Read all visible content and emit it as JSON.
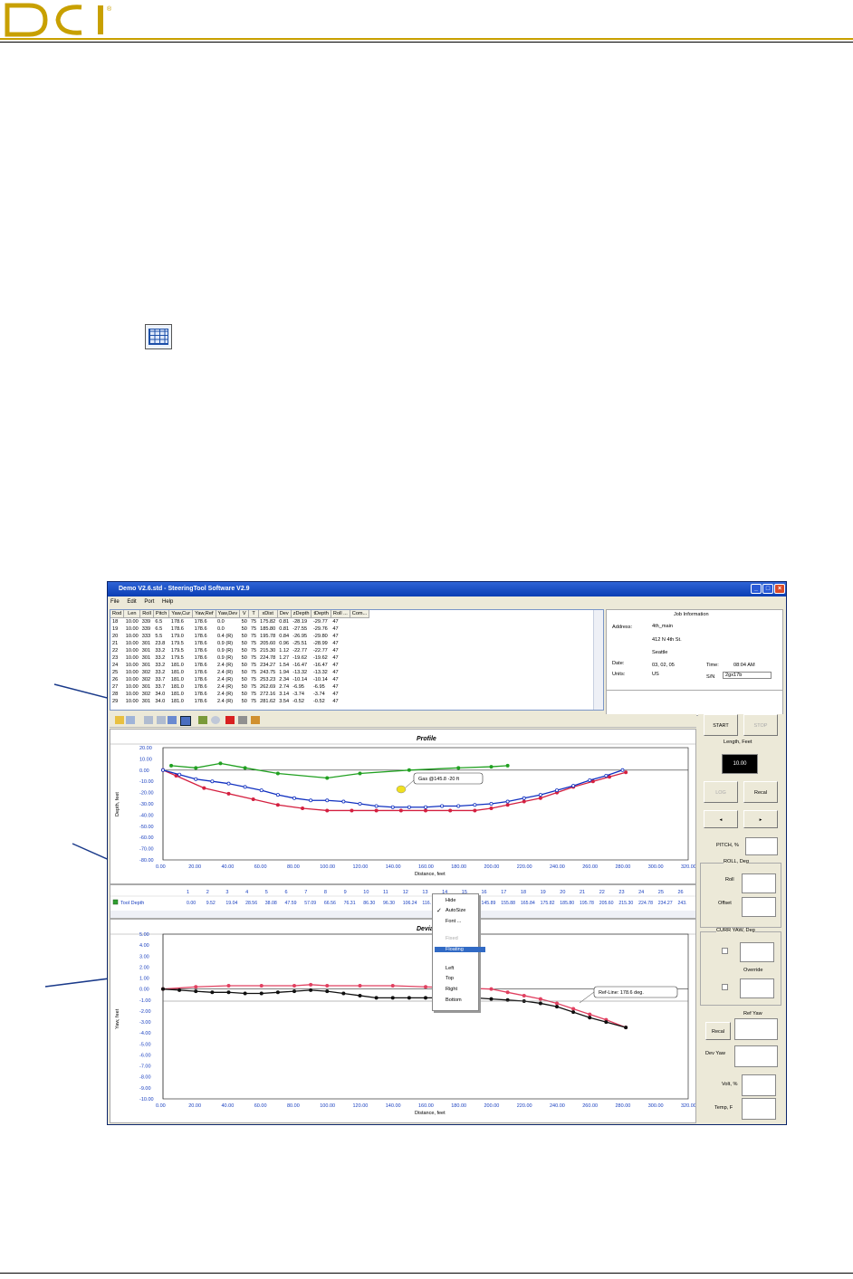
{
  "doc": {
    "logo_text": "DCI"
  },
  "window": {
    "title": "Demo V2.6.std - SteeringTool Software V2.9",
    "menu": [
      "File",
      "Edit",
      "Port",
      "Help"
    ]
  },
  "grid": {
    "headers": [
      "Rod",
      "Len",
      "Roll",
      "Pitch",
      "Yaw,Cur",
      "Yaw,Ref",
      "Yaw,Dev",
      "V",
      "T",
      "xDist",
      "Dev",
      "zDepth",
      "tDepth",
      "Roll ...",
      "Com..."
    ],
    "rows": [
      [
        "18",
        "10.00",
        "339",
        "6.5",
        "178.6",
        "178.6",
        "0.0",
        "50",
        "75",
        "175.82",
        "0.81",
        "-28.19",
        "-29.77",
        "47",
        ""
      ],
      [
        "19",
        "10.00",
        "339",
        "6.5",
        "178.6",
        "178.6",
        "0.0",
        "50",
        "75",
        "185.80",
        "0.81",
        "-27.55",
        "-29.76",
        "47",
        ""
      ],
      [
        "20",
        "10.00",
        "333",
        "5.5",
        "179.0",
        "178.6",
        "0.4 (R)",
        "50",
        "75",
        "195.78",
        "0.84",
        "-26.95",
        "-29.80",
        "47",
        ""
      ],
      [
        "21",
        "10.00",
        "301",
        "23.8",
        "179.5",
        "178.6",
        "0.9 (R)",
        "50",
        "75",
        "205.60",
        "0.96",
        "-25.51",
        "-28.99",
        "47",
        ""
      ],
      [
        "22",
        "10.00",
        "301",
        "33.2",
        "179.5",
        "178.6",
        "0.9 (R)",
        "50",
        "75",
        "215.30",
        "1.12",
        "-22.77",
        "-22.77",
        "47",
        ""
      ],
      [
        "23",
        "10.00",
        "301",
        "33.2",
        "179.5",
        "178.6",
        "0.9 (R)",
        "50",
        "75",
        "224.78",
        "1.27",
        "-19.62",
        "-19.62",
        "47",
        ""
      ],
      [
        "24",
        "10.00",
        "301",
        "33.2",
        "181.0",
        "178.6",
        "2.4 (R)",
        "50",
        "75",
        "234.27",
        "1.54",
        "-16.47",
        "-16.47",
        "47",
        ""
      ],
      [
        "25",
        "10.00",
        "302",
        "33.2",
        "181.0",
        "178.6",
        "2.4 (R)",
        "50",
        "75",
        "243.75",
        "1.94",
        "-13.32",
        "-13.32",
        "47",
        ""
      ],
      [
        "26",
        "10.00",
        "302",
        "33.7",
        "181.0",
        "178.6",
        "2.4 (R)",
        "50",
        "75",
        "253.23",
        "2.34",
        "-10.14",
        "-10.14",
        "47",
        ""
      ],
      [
        "27",
        "10.00",
        "301",
        "33.7",
        "181.0",
        "178.6",
        "2.4 (R)",
        "50",
        "75",
        "262.69",
        "2.74",
        "-6.95",
        "-6.95",
        "47",
        ""
      ],
      [
        "28",
        "10.00",
        "302",
        "34.0",
        "181.0",
        "178.6",
        "2.4 (R)",
        "50",
        "75",
        "272.16",
        "3.14",
        "-3.74",
        "-3.74",
        "47",
        ""
      ],
      [
        "29",
        "10.00",
        "301",
        "34.0",
        "181.0",
        "178.6",
        "2.4 (R)",
        "50",
        "75",
        "281.62",
        "3.54",
        "-0.52",
        "-0.52",
        "47",
        ""
      ]
    ]
  },
  "job": {
    "title": "Job Information",
    "address_label": "Address:",
    "address": [
      "4th_main",
      "412 N 4th St.",
      "Seattle"
    ],
    "date_label": "Date:",
    "date": "03, 02, 05",
    "time_label": "Time:",
    "time": "08:04 AM",
    "units_label": "Units:",
    "units": "US",
    "sn_label": "S/N",
    "sn": "2gx17b"
  },
  "profile": {
    "title": "Profile",
    "ylabel": "Depth, feet",
    "xlabel": "Distance, feet",
    "callout": "Gas @145.8 -20 ft"
  },
  "deviation": {
    "title": "Deviation",
    "ylabel": "Yaw, feet",
    "xlabel": "Distance, feet",
    "callout": "Ref-Line: 178.6 deg."
  },
  "mid": {
    "row_label": "Tool Depth",
    "cols": [
      "1",
      "2",
      "3",
      "4",
      "5",
      "6",
      "7",
      "8",
      "9",
      "10",
      "11",
      "12",
      "13",
      "14",
      "15",
      "16",
      "17",
      "18",
      "19",
      "20",
      "21",
      "22",
      "23",
      "24",
      "25",
      "26"
    ],
    "vals": [
      "0.00",
      "9.52",
      "19.04",
      "28.56",
      "38.08",
      "47.59",
      "57.09",
      "66.56",
      "76.31",
      "86.30",
      "96.30",
      "106.24",
      "116.",
      "",
      "",
      "145.89",
      "155.88",
      "165.84",
      "175.82",
      "185.80",
      "195.78",
      "205.60",
      "215.30",
      "224.78",
      "234.27",
      "243."
    ]
  },
  "ctxmenu": {
    "items": [
      "Hide",
      "AutoSize",
      "Font ...",
      "Fixed",
      "Floating",
      "Left",
      "Top",
      "Right",
      "Bottom"
    ]
  },
  "right": {
    "start": "START",
    "stop": "STOP",
    "length_label": "Length, Feet",
    "length_value": "10.00",
    "log": "LOG",
    "recal": "Recal",
    "pitch_label": "PITCH, %",
    "roll_group": "ROLL, Deg",
    "roll": "Roll",
    "offset": "Offset",
    "yaw_group": "CURR YAW, Deg",
    "override": "Override",
    "ref_yaw": "Ref Yaw",
    "recal2": "Recal",
    "dev_yaw": "Dev Yaw",
    "volt": "Volt, %",
    "temp": "Temp, F"
  },
  "chart_data": [
    {
      "type": "line",
      "title": "Profile",
      "xlabel": "Distance, feet",
      "ylabel": "Depth, feet",
      "xlim": [
        0,
        320
      ],
      "ylim": [
        -80,
        20
      ],
      "xticks": [
        "0.00",
        "20.00",
        "40.00",
        "60.00",
        "80.00",
        "100.00",
        "120.00",
        "140.00",
        "160.00",
        "180.00",
        "200.00",
        "220.00",
        "240.00",
        "260.00",
        "280.00",
        "300.00",
        "320.00"
      ],
      "yticks": [
        "20.00",
        "10.00",
        "0.00",
        "-10.00",
        "-20.00",
        "-30.00",
        "-40.00",
        "-50.00",
        "-60.00",
        "-70.00",
        "-80.00"
      ],
      "series": [
        {
          "color": "#d42040",
          "x": [
            0,
            8,
            25,
            40,
            55,
            70,
            85,
            100,
            115,
            130,
            145,
            160,
            175,
            190,
            200,
            210,
            220,
            230,
            240,
            250,
            262,
            272,
            282
          ],
          "y": [
            0,
            -5,
            -16,
            -21,
            -26,
            -31,
            -34,
            -36,
            -36,
            -36,
            -36,
            -36,
            -36,
            -36,
            -34,
            -31,
            -28,
            -25,
            -20,
            -15,
            -10,
            -6,
            -2
          ]
        },
        {
          "color": "#1030c0",
          "x": [
            0,
            10,
            20,
            30,
            40,
            50,
            60,
            70,
            80,
            90,
            100,
            110,
            120,
            130,
            140,
            150,
            160,
            170,
            180,
            190,
            200,
            210,
            220,
            230,
            240,
            250,
            260,
            270,
            280
          ],
          "y": [
            0,
            -4,
            -8,
            -10,
            -12,
            -15,
            -18,
            -22,
            -25,
            -27,
            -27,
            -28,
            -30,
            -32,
            -33,
            -33,
            -33,
            -32,
            -32,
            -31,
            -30,
            -28,
            -25,
            -22,
            -18,
            -14,
            -9,
            -5,
            0
          ]
        },
        {
          "color": "#20a020",
          "x": [
            5,
            20,
            35,
            50,
            70,
            100,
            120,
            150,
            180,
            200,
            210
          ],
          "y": [
            4,
            2,
            6,
            2,
            -3,
            -7,
            -3,
            0,
            2,
            3,
            4
          ]
        }
      ]
    },
    {
      "type": "line",
      "title": "Deviation",
      "xlabel": "Distance, feet",
      "ylabel": "Yaw, feet",
      "xlim": [
        0,
        320
      ],
      "ylim": [
        -10,
        5
      ],
      "xticks": [
        "0.00",
        "20.00",
        "40.00",
        "60.00",
        "80.00",
        "100.00",
        "120.00",
        "140.00",
        "160.00",
        "180.00",
        "200.00",
        "220.00",
        "240.00",
        "260.00",
        "280.00",
        "300.00",
        "320.00"
      ],
      "yticks": [
        "5.00",
        "4.00",
        "3.00",
        "2.00",
        "1.00",
        "0.00",
        "-1.00",
        "-2.00",
        "-3.00",
        "-4.00",
        "-5.00",
        "-6.00",
        "-7.00",
        "-8.00",
        "-9.00",
        "-10.00"
      ],
      "series": [
        {
          "color": "#e04060",
          "x": [
            0,
            20,
            40,
            60,
            80,
            90,
            100,
            120,
            140,
            160,
            180,
            200,
            210,
            220,
            230,
            240,
            250,
            260,
            270,
            282
          ],
          "y": [
            0,
            0.2,
            0.3,
            0.3,
            0.3,
            0.4,
            0.3,
            0.3,
            0.3,
            0.2,
            0.1,
            0,
            -0.3,
            -0.6,
            -0.9,
            -1.3,
            -1.8,
            -2.3,
            -2.8,
            -3.5
          ]
        },
        {
          "color": "#101010",
          "x": [
            0,
            10,
            20,
            30,
            40,
            50,
            60,
            70,
            80,
            90,
            100,
            110,
            120,
            130,
            140,
            150,
            160,
            170,
            180,
            190,
            200,
            210,
            220,
            230,
            240,
            250,
            260,
            270,
            282
          ],
          "y": [
            0,
            -0.1,
            -0.2,
            -0.3,
            -0.3,
            -0.4,
            -0.4,
            -0.3,
            -0.2,
            -0.1,
            -0.2,
            -0.4,
            -0.6,
            -0.8,
            -0.8,
            -0.8,
            -0.8,
            -0.8,
            -0.8,
            -0.8,
            -0.9,
            -1.0,
            -1.1,
            -1.3,
            -1.6,
            -2.1,
            -2.6,
            -3.0,
            -3.5
          ]
        }
      ]
    }
  ]
}
